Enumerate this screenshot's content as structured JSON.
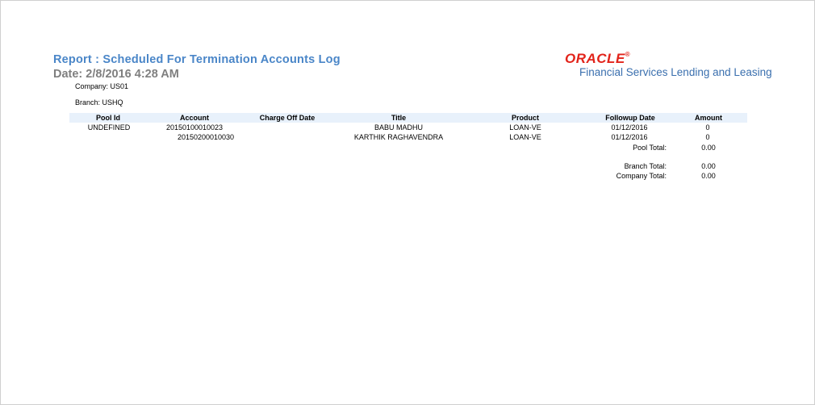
{
  "report": {
    "title": "Report : Scheduled For Termination Accounts Log",
    "date": "Date: 2/8/2016  4:28 AM",
    "company": "Company: US01",
    "branch": "Branch: USHQ"
  },
  "brand": {
    "name": "ORACLE",
    "registered": "®",
    "subtitle": "Financial Services Lending and Leasing",
    "colors": {
      "logo": "#e2231a",
      "subtitle": "#3a6fae",
      "title": "#4a86c8",
      "date": "#7f7f7f",
      "header_bar": "#e8f1fb"
    }
  },
  "table": {
    "headers": {
      "pool_id": "Pool Id",
      "account": "Account",
      "charge_off_date": "Charge Off Date",
      "title": "Title",
      "product": "Product",
      "followup_date": "Followup Date",
      "amount": "Amount"
    },
    "rows": [
      {
        "pool_id": "UNDEFINED",
        "account": "20150100010023",
        "charge_off_date": "",
        "title": "BABU MADHU",
        "product": "LOAN-VE",
        "followup_date": "01/12/2016",
        "amount": "0"
      },
      {
        "pool_id": "",
        "account": "20150200010030",
        "charge_off_date": "",
        "title": "KARTHIK RAGHAVENDRA",
        "product": "LOAN-VE",
        "followup_date": "01/12/2016",
        "amount": "0"
      }
    ],
    "totals": {
      "pool_label": "Pool Total:",
      "pool_value": "0.00",
      "branch_label": "Branch Total:",
      "branch_value": "0.00",
      "company_label": "Company Total:",
      "company_value": "0.00"
    }
  }
}
